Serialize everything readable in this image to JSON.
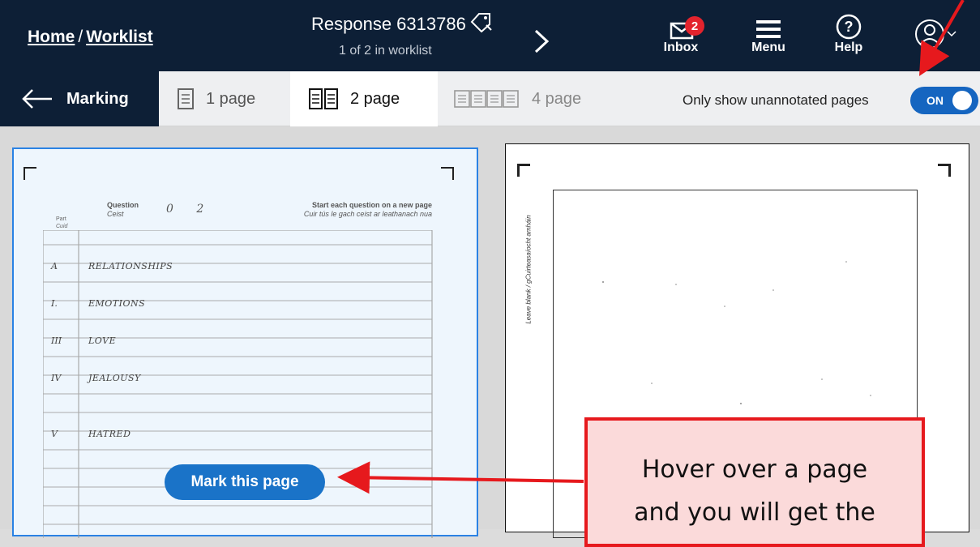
{
  "breadcrumb": {
    "home": "Home",
    "separator": "/",
    "worklist": "Worklist"
  },
  "response": {
    "title": "Response 6313786",
    "position": "1 of 2 in worklist"
  },
  "topnav": {
    "inbox": {
      "label": "Inbox",
      "count": "2"
    },
    "menu": {
      "label": "Menu"
    },
    "help": {
      "label": "Help"
    }
  },
  "toolbar": {
    "back_label": "Marking",
    "views": [
      {
        "label": "1 page",
        "active": false
      },
      {
        "label": "2 page",
        "active": true
      },
      {
        "label": "4 page",
        "active": false
      }
    ],
    "filter_label": "Only show unannotated pages",
    "toggle_state": "ON"
  },
  "page_left": {
    "header_question": "Question",
    "header_question_ga": "Ceist",
    "question_number": "0 2",
    "header_instructions": "Start each question on a new page",
    "header_instructions_ga": "Cuir tús le gach ceist ar leathanach nua",
    "part_label": "Part",
    "part_label_ga": "Cuid",
    "rows": [
      {
        "part": "A",
        "text": "RELATIONSHIPS"
      },
      {
        "part": "I.",
        "text": "EMOTIONS"
      },
      {
        "part": "III",
        "text": "LOVE"
      },
      {
        "part": "IV",
        "text": "JEALOUSY"
      },
      {
        "part": "V",
        "text": "HATRED"
      }
    ]
  },
  "page_right": {
    "margin_text": "Leave blank / gCuirteasaíocht amháin"
  },
  "mark_button_label": "Mark this page",
  "callout": {
    "line1": "Hover over a page",
    "line2": "and you will get the"
  },
  "colors": {
    "topbar": "#0d1f36",
    "accent": "#1a73c8",
    "toggle": "#1565c0",
    "callout_border": "#e6191d",
    "callout_fill": "#fbdada",
    "badge": "#e3232d"
  }
}
